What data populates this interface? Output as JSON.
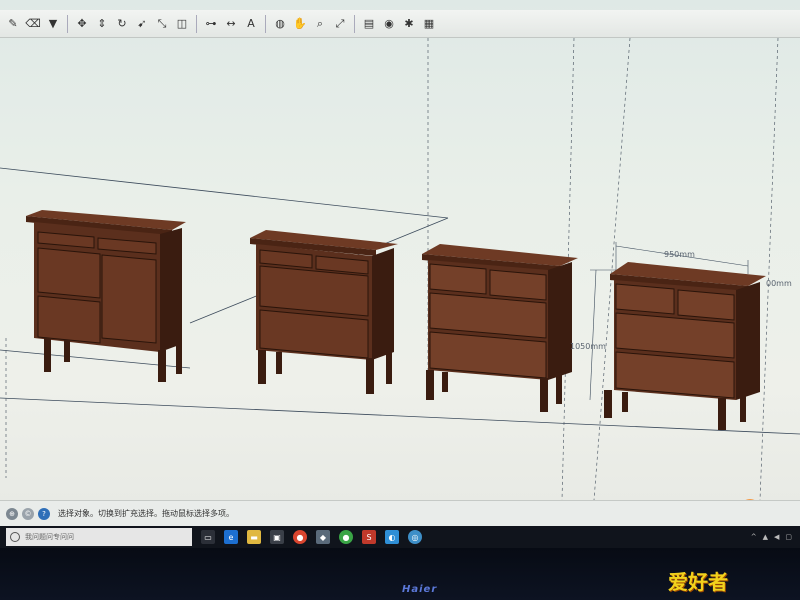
{
  "toolbar": {
    "items": [
      {
        "icon": "pencil-icon",
        "interactable": true
      },
      {
        "icon": "eraser-icon",
        "interactable": true
      },
      {
        "icon": "paint-bucket-icon",
        "interactable": true
      },
      {
        "icon": "move-icon",
        "interactable": true
      },
      {
        "icon": "push-pull-icon",
        "interactable": true
      },
      {
        "icon": "rotate-icon",
        "interactable": true
      },
      {
        "icon": "follow-me-icon",
        "interactable": true
      },
      {
        "icon": "scale-icon",
        "interactable": true
      },
      {
        "icon": "offset-icon",
        "interactable": true
      },
      {
        "icon": "tape-measure-icon",
        "interactable": true
      },
      {
        "icon": "dimension-icon",
        "interactable": true
      },
      {
        "icon": "text-icon",
        "interactable": true
      },
      {
        "icon": "orbit-icon",
        "interactable": true
      },
      {
        "icon": "pan-icon",
        "interactable": true
      },
      {
        "icon": "zoom-icon",
        "interactable": true
      },
      {
        "icon": "zoom-extents-icon",
        "interactable": true
      },
      {
        "icon": "warehouse-icon",
        "interactable": true
      },
      {
        "icon": "share-model-icon",
        "interactable": true
      },
      {
        "icon": "extension-icon",
        "interactable": true
      },
      {
        "icon": "layout-icon",
        "interactable": true
      }
    ]
  },
  "model": {
    "dimension_width": "950mm",
    "dimension_height": "1050mm",
    "dimension_depth": "00mm",
    "colors": {
      "wood": "#5b2f1d",
      "wood_light": "#7a4530",
      "wood_dark": "#3a1c10",
      "guide": "#3c4b5c"
    }
  },
  "status": {
    "text": "选择对象。切换到扩充选择。拖动鼠标选择多项。"
  },
  "taskbar": {
    "search_placeholder": "我问题问专问问",
    "apps": [
      "task-view-icon",
      "edge-icon",
      "file-explorer-icon",
      "store-icon",
      "chrome-icon",
      "app-icon",
      "wechat-icon",
      "sketchup-icon",
      "photos-icon",
      "browser-icon"
    ]
  },
  "bezel": {
    "brand": "Haier"
  },
  "watermark": "爱好者"
}
